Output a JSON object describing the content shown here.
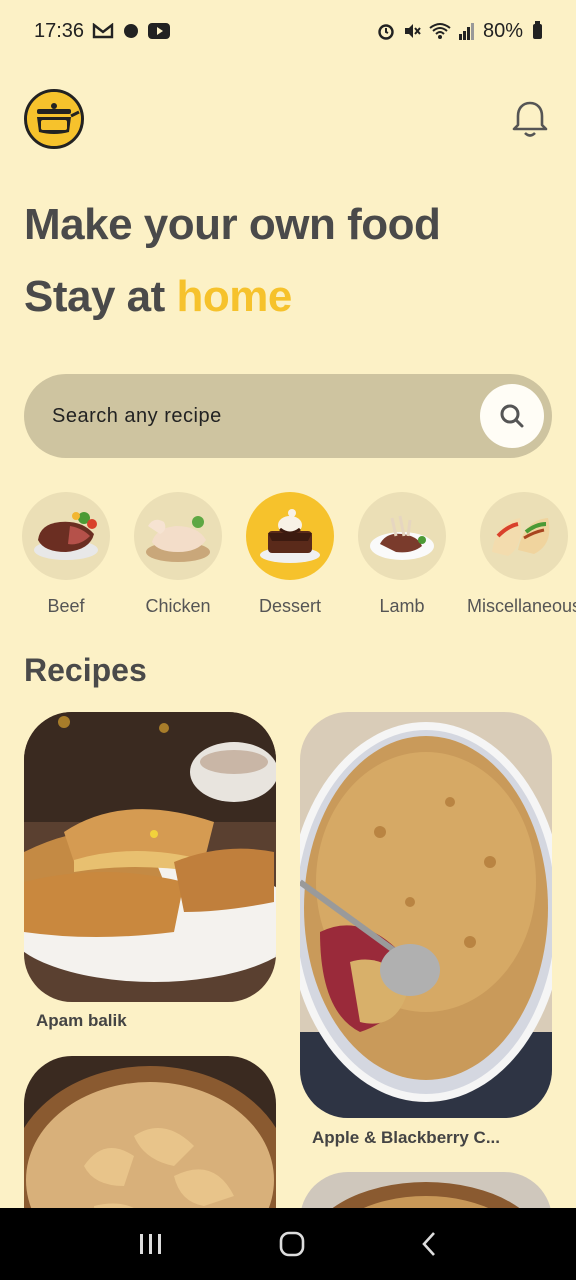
{
  "status_bar": {
    "time": "17:36",
    "battery": "80%"
  },
  "hero": {
    "line1": "Make your own food",
    "line2_prefix": "Stay at ",
    "line2_accent": "home"
  },
  "colors": {
    "background": "#fcf1c6",
    "accent": "#f6c22c",
    "search_bg": "#cec4a0"
  },
  "search": {
    "placeholder": "Search any recipe",
    "icon": "search-icon"
  },
  "categories": [
    {
      "label": "Beef",
      "active": false
    },
    {
      "label": "Chicken",
      "active": false
    },
    {
      "label": "Dessert",
      "active": true
    },
    {
      "label": "Lamb",
      "active": false
    },
    {
      "label": "Miscellaneous",
      "active": false
    }
  ],
  "recipes_title": "Recipes",
  "recipes": [
    {
      "name": "Apam balik"
    },
    {
      "name": "Apple & Blackberry C..."
    }
  ],
  "icons": {
    "logo": "pot-logo-icon",
    "notifications": "bell-icon",
    "nav_recents": "recents-icon",
    "nav_home": "home-icon",
    "nav_back": "back-icon"
  }
}
